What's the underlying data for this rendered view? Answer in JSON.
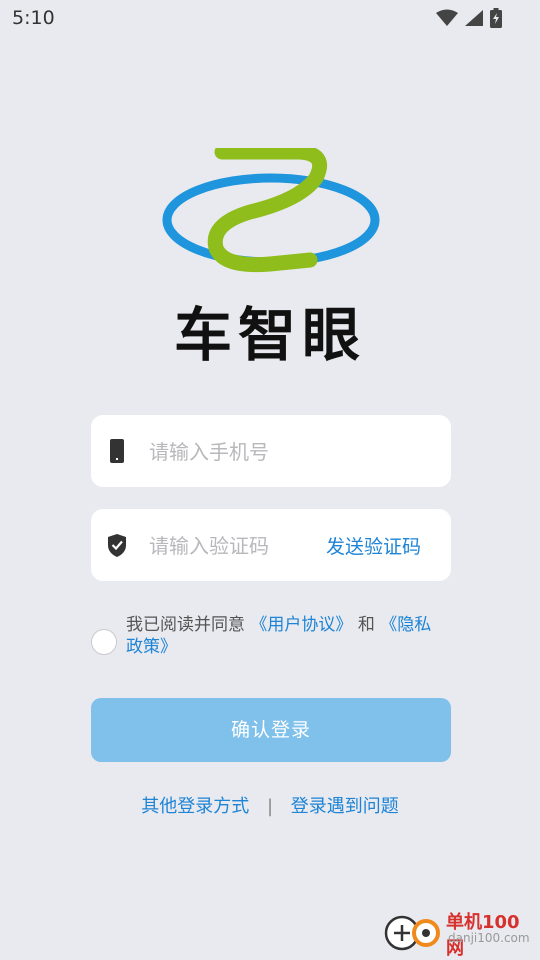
{
  "status_bar": {
    "time": "5:10",
    "icons": [
      "wifi-icon",
      "signal-icon",
      "battery-charging-icon"
    ]
  },
  "brand": {
    "name": "车智眼",
    "logo": "car-eye-logo",
    "colors": {
      "blue": "#1e95dd",
      "green": "#8ebd1c"
    }
  },
  "form": {
    "phone_placeholder": "请输入手机号",
    "phone_icon": "phone-icon",
    "code_placeholder": "请输入验证码",
    "code_icon": "shield-icon",
    "send_code_label": "发送验证码"
  },
  "agreement": {
    "prefix": "我已阅读并同意",
    "user_agreement": "《用户协议》",
    "and": "和",
    "privacy_policy": "《隐私政策》"
  },
  "confirm_button": "确认登录",
  "bottom_links": {
    "other_login": "其他登录方式",
    "separator": "|",
    "login_problem": "登录遇到问题"
  },
  "watermark": {
    "site_name": "单机100网",
    "site_url": "danji100.com"
  },
  "colors": {
    "background": "#e9eaef",
    "accent": "#1d84d6",
    "button": "#7fc1ea"
  }
}
